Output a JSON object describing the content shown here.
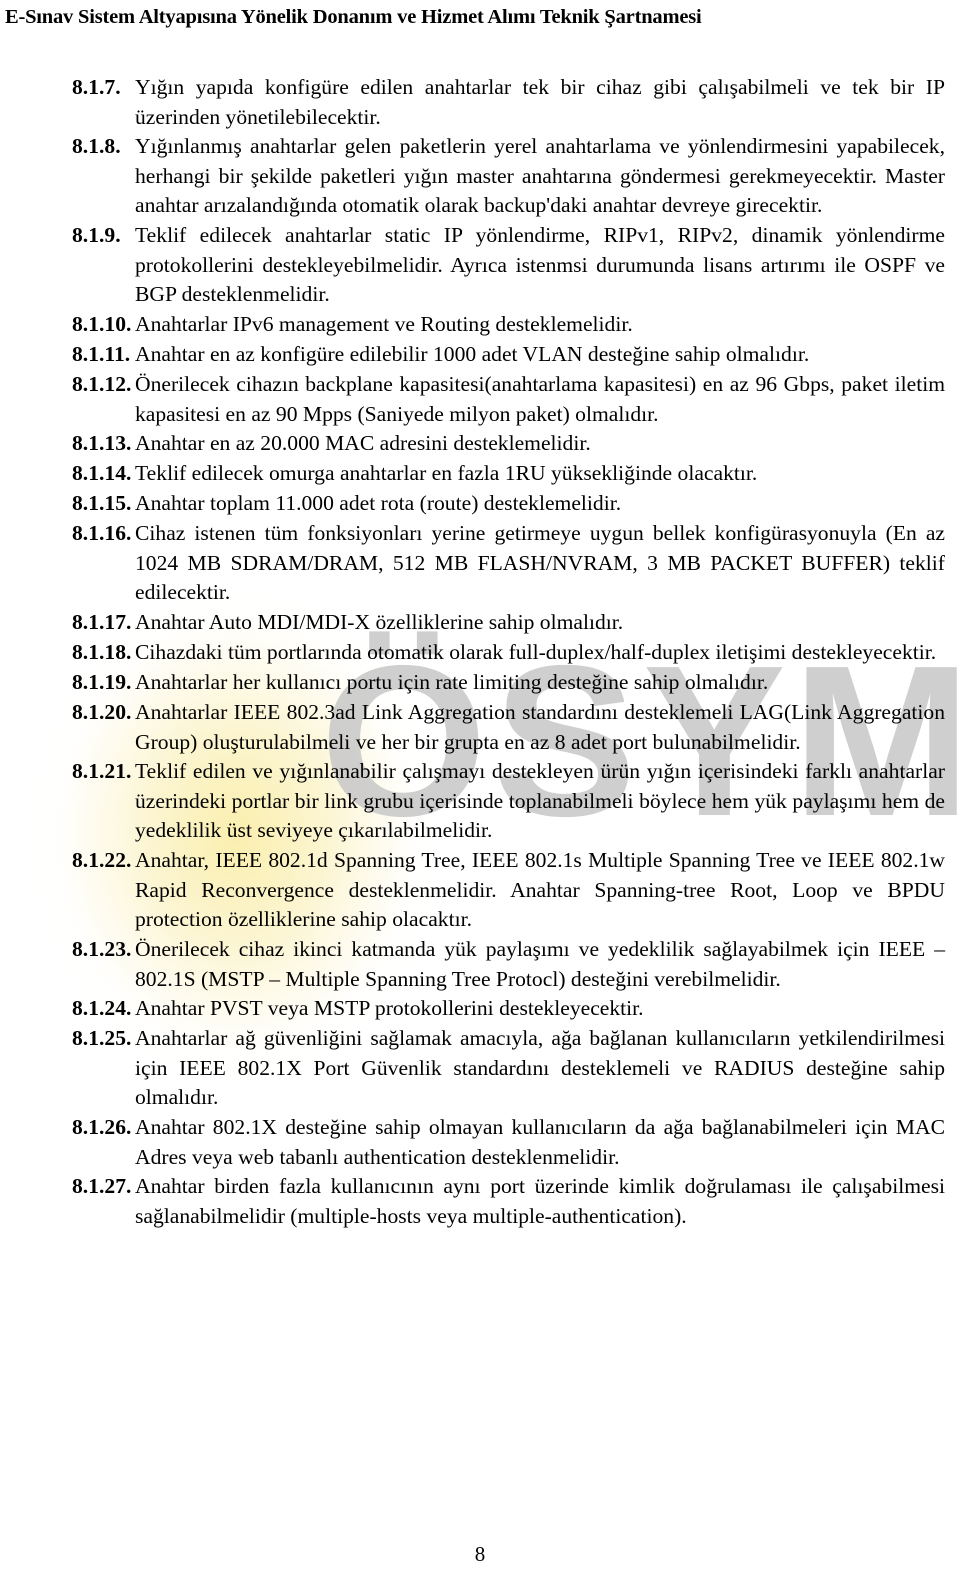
{
  "document": {
    "header_title": "E-Sınav Sistem Altyapısına Yönelik Donanım ve Hizmet Alımı Teknik Şartnamesi",
    "page_number": "8",
    "watermark_text": "ÖSYM",
    "watermark_color": "#c9c9c9",
    "glow_color": "#faeeaa",
    "text_color": "#000000",
    "background_color": "#ffffff"
  },
  "clauses": [
    {
      "number": "8.1.7.",
      "text": "Yığın yapıda konfigüre edilen anahtarlar tek bir cihaz gibi çalışabilmeli ve tek bir IP üzerinden yönetilebilecektir."
    },
    {
      "number": "8.1.8.",
      "text": "Yığınlanmış anahtarlar gelen paketlerin yerel anahtarlama ve yönlendirmesini yapabilecek, herhangi bir şekilde paketleri yığın master anahtarına göndermesi gerekmeyecektir. Master anahtar arızalandığında otomatik olarak backup'daki anahtar devreye girecektir."
    },
    {
      "number": "8.1.9.",
      "text": "Teklif edilecek anahtarlar static IP yönlendirme, RIPv1, RIPv2, dinamik yönlendirme protokollerini destekleyebilmelidir. Ayrıca istenmsi durumunda lisans artırımı ile OSPF ve BGP desteklenmelidir."
    },
    {
      "number": "8.1.10.",
      "text": "Anahtarlar IPv6 management ve Routing desteklemelidir."
    },
    {
      "number": "8.1.11.",
      "text": "Anahtar en az konfigüre edilebilir 1000 adet VLAN desteğine sahip olmalıdır."
    },
    {
      "number": "8.1.12.",
      "text": "Önerilecek cihazın backplane kapasitesi(anahtarlama kapasitesi) en az 96 Gbps, paket iletim kapasitesi en az 90 Mpps (Saniyede  milyon paket) olmalıdır."
    },
    {
      "number": "8.1.13.",
      "text": "Anahtar en az 20.000 MAC adresini desteklemelidir."
    },
    {
      "number": "8.1.14.",
      "text": "Teklif edilecek omurga anahtarlar en fazla 1RU yüksekliğinde olacaktır."
    },
    {
      "number": "8.1.15.",
      "text": "Anahtar toplam 11.000 adet rota (route) desteklemelidir."
    },
    {
      "number": "8.1.16.",
      "text": "Cihaz istenen tüm fonksiyonları yerine getirmeye uygun bellek konfigürasyonuyla (En az 1024 MB SDRAM/DRAM, 512 MB FLASH/NVRAM, 3 MB PACKET BUFFER) teklif edilecektir."
    },
    {
      "number": "8.1.17.",
      "text": "Anahtar Auto MDI/MDI-X özelliklerine sahip olmalıdır."
    },
    {
      "number": "8.1.18.",
      "text": "Cihazdaki tüm portlarında otomatik olarak full-duplex/half-duplex iletişimi destekleyecektir."
    },
    {
      "number": "8.1.19.",
      "text": "Anahtarlar her kullanıcı portu için rate limiting desteğine sahip olmalıdır."
    },
    {
      "number": "8.1.20.",
      "text": "Anahtarlar IEEE 802.3ad Link Aggregation standardını desteklemeli LAG(Link Aggregation Group) oluşturulabilmeli ve her bir grupta en az 8 adet port bulunabilmelidir."
    },
    {
      "number": "8.1.21.",
      "text": "Teklif edilen ve yığınlanabilir çalışmayı destekleyen ürün yığın içerisindeki farklı anahtarlar üzerindeki portlar bir link grubu içerisinde toplanabilmeli böylece hem yük paylaşımı hem de yedeklilik üst seviyeye çıkarılabilmelidir."
    },
    {
      "number": "8.1.22.",
      "text": "Anahtar, IEEE 802.1d Spanning Tree, IEEE 802.1s Multiple Spanning Tree ve IEEE 802.1w Rapid Reconvergence desteklenmelidir. Anahtar Spanning-tree Root, Loop ve BPDU protection özelliklerine sahip olacaktır."
    },
    {
      "number": "8.1.23.",
      "text": "Önerilecek cihaz ikinci katmanda yük paylaşımı ve yedeklilik sağlayabilmek için IEEE – 802.1S (MSTP – Multiple Spanning Tree Protocl) desteğini verebilmelidir."
    },
    {
      "number": "8.1.24.",
      "text": "Anahtar PVST veya MSTP protokollerini destekleyecektir."
    },
    {
      "number": "8.1.25.",
      "text": "Anahtarlar ağ güvenliğini sağlamak amacıyla, ağa bağlanan kullanıcıların yetkilendirilmesi için IEEE 802.1X Port Güvenlik standardını desteklemeli ve RADIUS desteğine sahip olmalıdır."
    },
    {
      "number": "8.1.26.",
      "text": "Anahtar 802.1X desteğine sahip olmayan kullanıcıların da ağa bağlanabilmeleri için MAC Adres veya web tabanlı authentication desteklenmelidir."
    },
    {
      "number": "8.1.27.",
      "text": "Anahtar birden fazla kullanıcının aynı port üzerinde kimlik doğrulaması ile çalışabilmesi sağlanabilmelidir (multiple-hosts veya multiple-authentication)."
    }
  ]
}
